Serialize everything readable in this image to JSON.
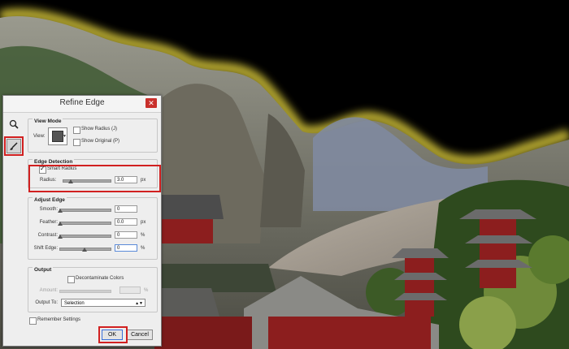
{
  "dialog": {
    "title": "Refine Edge",
    "close_glyph": "✕"
  },
  "tools": {
    "zoom_icon": "magnifier-icon",
    "hand_icon": "hand-icon",
    "refine_brush_icon": "refine-radius-brush-icon"
  },
  "view_mode": {
    "heading": "View Mode",
    "view_label": "View:",
    "show_radius": {
      "label": "Show Radius (J)",
      "checked": false
    },
    "show_original": {
      "label": "Show Original (P)",
      "checked": false
    }
  },
  "edge_detection": {
    "heading": "Edge Detection",
    "smart_radius": {
      "label": "Smart Radius",
      "checked": true
    },
    "radius_label": "Radius:",
    "radius_value": "3.0",
    "radius_unit": "px"
  },
  "adjust_edge": {
    "heading": "Adjust Edge",
    "rows": [
      {
        "label": "Smooth:",
        "value": "0",
        "unit": ""
      },
      {
        "label": "Feather:",
        "value": "0.0",
        "unit": "px"
      },
      {
        "label": "Contrast:",
        "value": "0",
        "unit": "%"
      },
      {
        "label": "Shift Edge:",
        "value": "0",
        "unit": "%"
      }
    ]
  },
  "output": {
    "heading": "Output",
    "decontaminate": {
      "label": "Decontaminate Colors",
      "checked": false
    },
    "amount_label": "Amount:",
    "amount_unit": "%",
    "output_to_label": "Output To:",
    "output_to_value": "Selection"
  },
  "remember_settings": {
    "label": "Remember Settings",
    "checked": false
  },
  "buttons": {
    "ok": "OK",
    "cancel": "Cancel"
  },
  "colors": {
    "highlight_red": "#d12020",
    "edge_glow": "#d8c83a"
  }
}
